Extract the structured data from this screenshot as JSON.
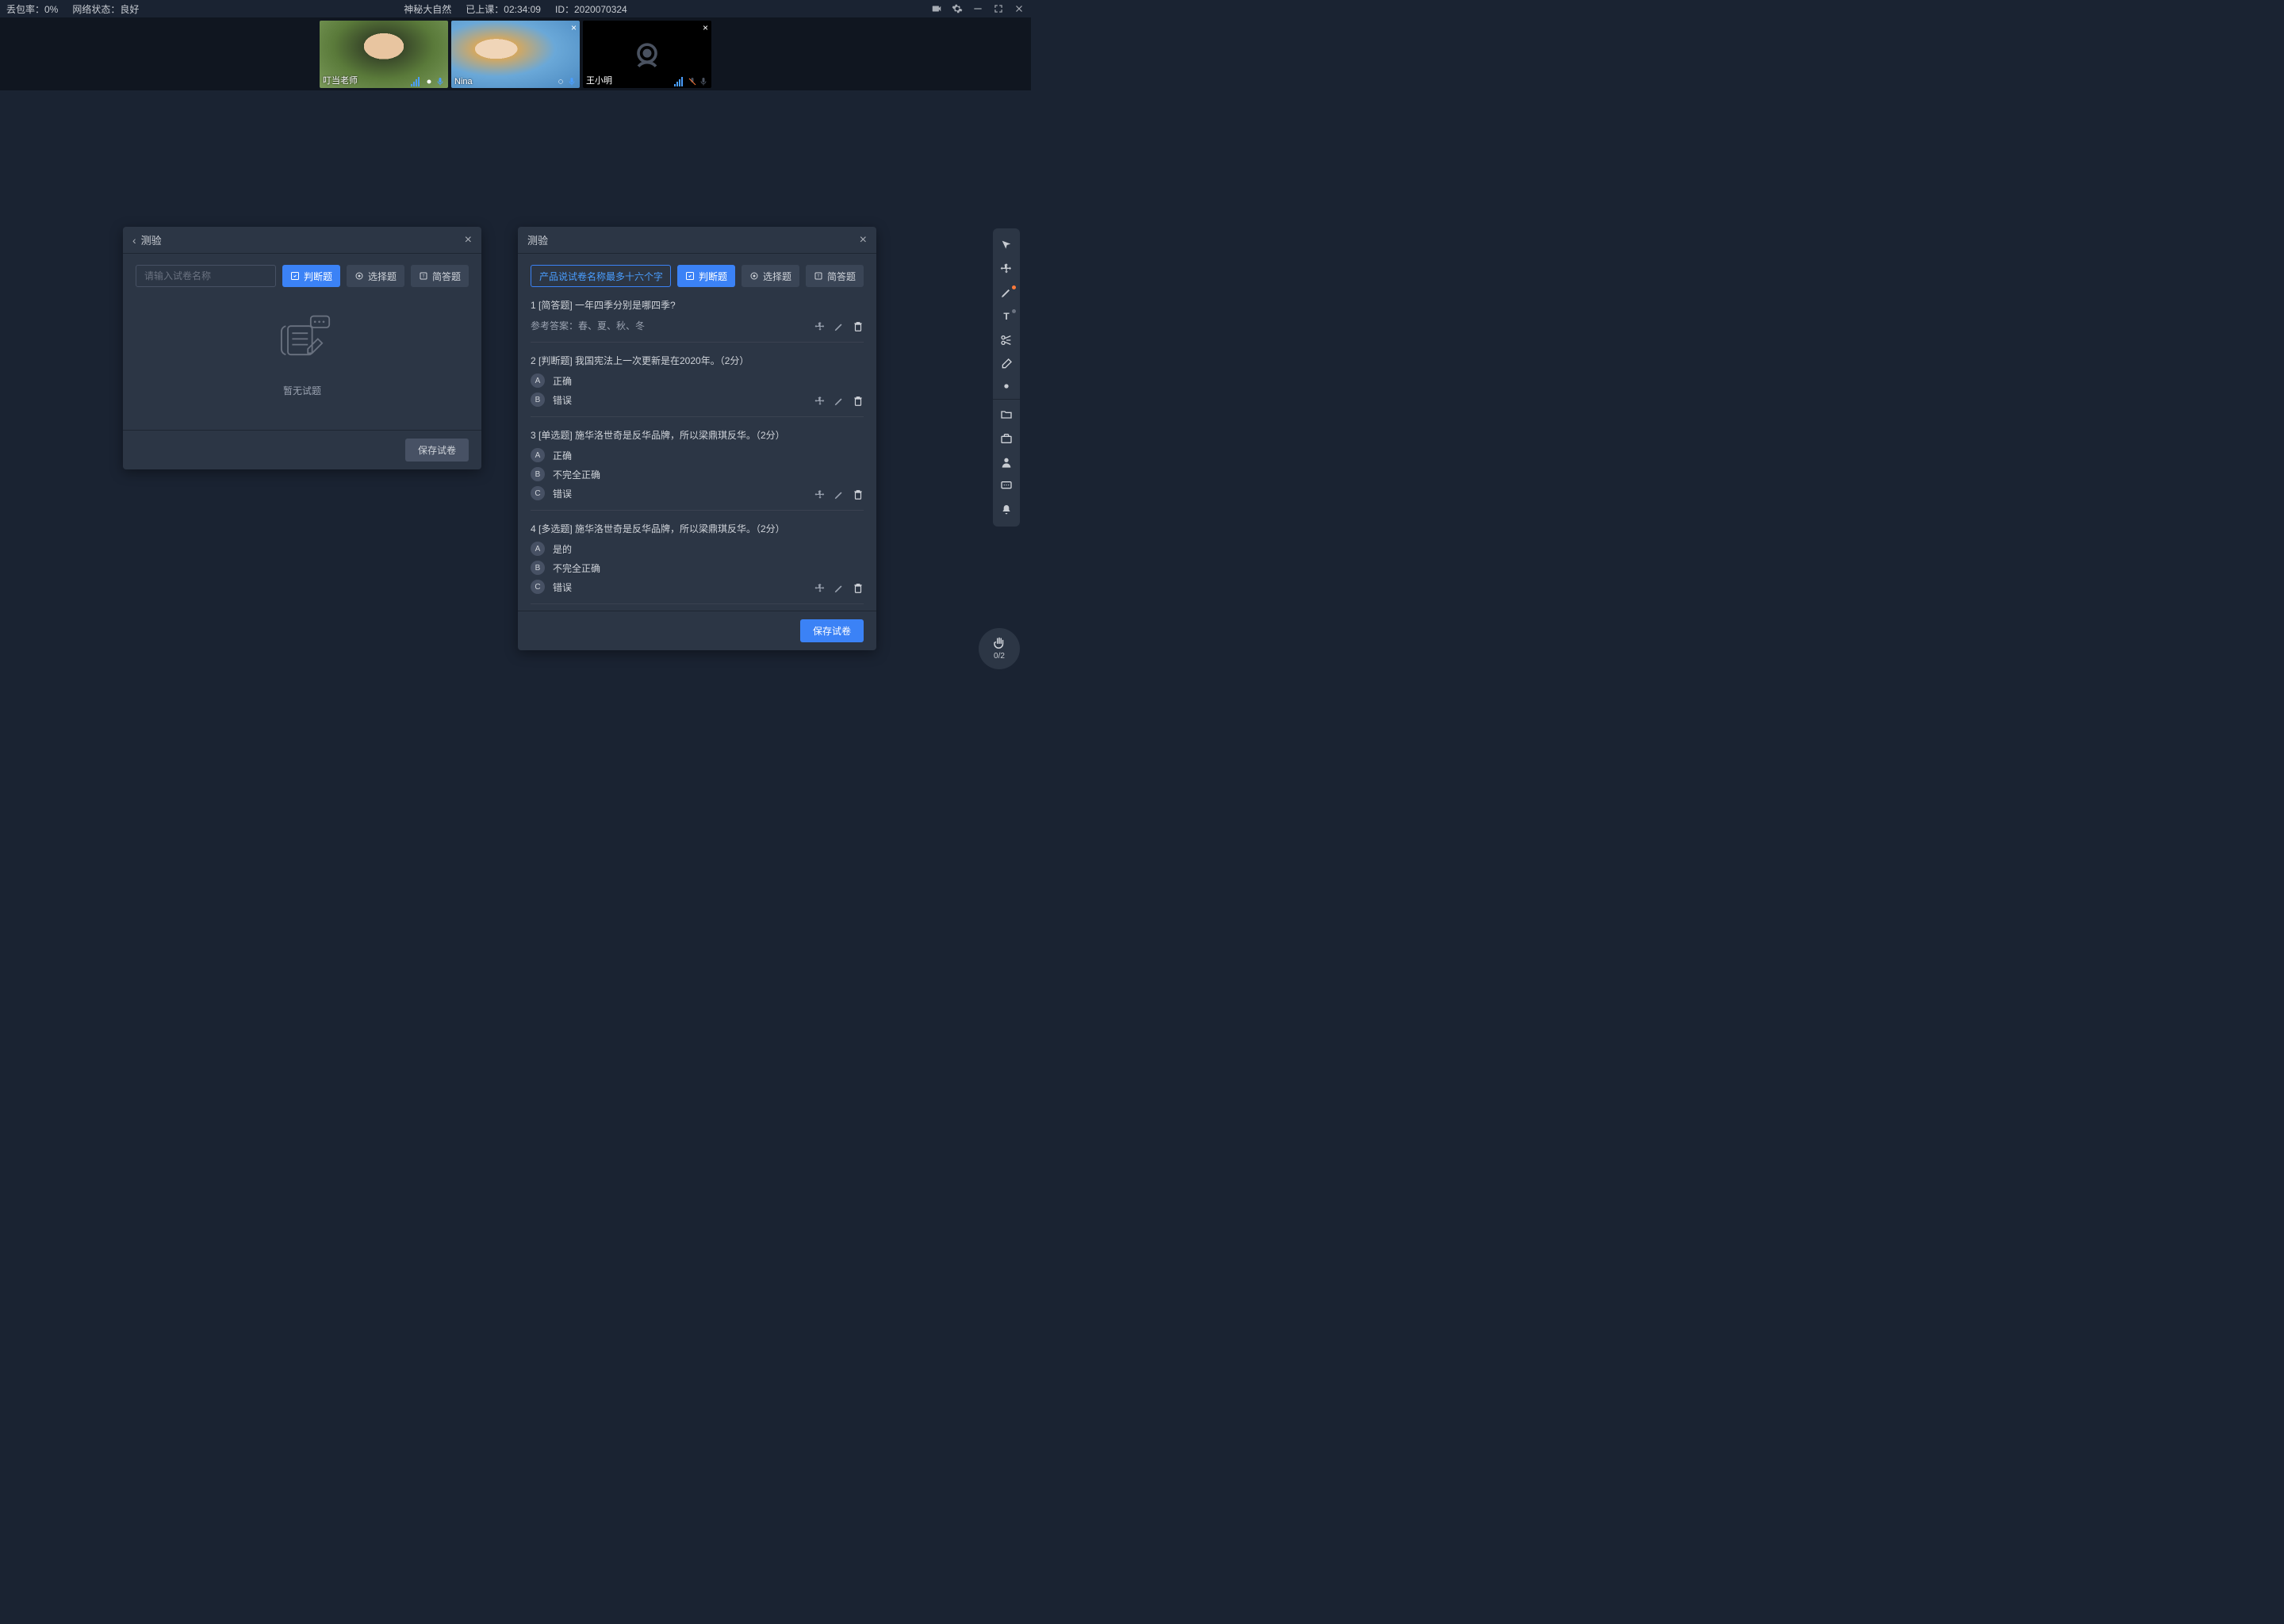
{
  "topbar": {
    "packet_loss_label": "丢包率：0%",
    "network_label": "网络状态：良好",
    "title": "神秘大自然",
    "class_time": "已上课：02:34:09",
    "session_id": "ID：2020070324"
  },
  "videos": [
    {
      "name": "叮当老师",
      "camera_on": true,
      "mic_muted": false,
      "closable": false
    },
    {
      "name": "Nina",
      "camera_on": true,
      "mic_muted": false,
      "closable": true
    },
    {
      "name": "王小明",
      "camera_on": false,
      "mic_muted": true,
      "closable": true
    }
  ],
  "panel_left": {
    "title": "测验",
    "name_placeholder": "请输入试卷名称",
    "name_value": "",
    "buttons": {
      "judge": "判断题",
      "choice": "选择题",
      "short": "简答题"
    },
    "empty_text": "暂无试题",
    "save_label": "保存试卷"
  },
  "panel_right": {
    "title": "测验",
    "name_value": "产品说试卷名称最多十六个字",
    "buttons": {
      "judge": "判断题",
      "choice": "选择题",
      "short": "简答题"
    },
    "save_label": "保存试卷",
    "questions": [
      {
        "num": "1",
        "tag": "[简答题]",
        "text": "一年四季分别是哪四季?",
        "reference_label": "参考答案：",
        "reference": "春、夏、秋、冬",
        "options": []
      },
      {
        "num": "2",
        "tag": "[判断题]",
        "text": "我国宪法上一次更新是在2020年。（2分）",
        "options": [
          {
            "badge": "A",
            "text": "正确"
          },
          {
            "badge": "B",
            "text": "错误"
          }
        ]
      },
      {
        "num": "3",
        "tag": "[单选题]",
        "text": "施华洛世奇是反华品牌，所以梁鼎琪反华。（2分）",
        "options": [
          {
            "badge": "A",
            "text": "正确"
          },
          {
            "badge": "B",
            "text": "不完全正确"
          },
          {
            "badge": "C",
            "text": "错误"
          }
        ]
      },
      {
        "num": "4",
        "tag": "[多选题]",
        "text": "施华洛世奇是反华品牌，所以梁鼎琪反华。（2分）",
        "options": [
          {
            "badge": "A",
            "text": "是的"
          },
          {
            "badge": "B",
            "text": "不完全正确"
          },
          {
            "badge": "C",
            "text": "错误"
          }
        ]
      }
    ]
  },
  "hand_raise": {
    "count": "0/2"
  }
}
